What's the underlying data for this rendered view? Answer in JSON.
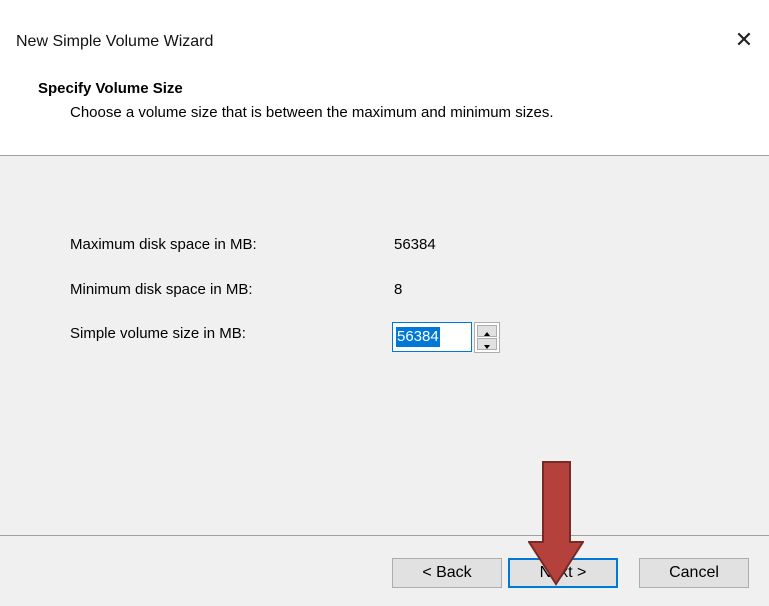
{
  "window": {
    "title": "New Simple Volume Wizard",
    "close_glyph": "✕"
  },
  "header": {
    "title": "Specify Volume Size",
    "subtitle": "Choose a volume size that is between the maximum and minimum sizes."
  },
  "fields": {
    "max_label": "Maximum disk space in MB:",
    "max_value": "56384",
    "min_label": "Minimum disk space in MB:",
    "min_value": "8",
    "size_label": "Simple volume size in MB:",
    "size_value": "56384"
  },
  "buttons": {
    "back": "< Back",
    "next": "Next >",
    "cancel": "Cancel"
  },
  "annotation": {
    "arrow_color": "#b5413c",
    "arrow_outline": "#7a2a26",
    "icon": "down-arrow-icon"
  },
  "colors": {
    "accent": "#0078d7",
    "panel_bg": "#f0f0f0"
  }
}
